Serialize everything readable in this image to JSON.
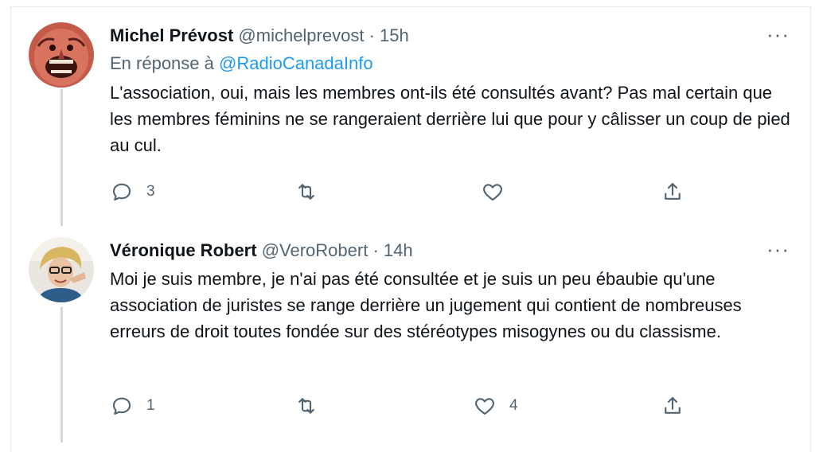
{
  "tweets": [
    {
      "name": "Michel Prévost",
      "handle": "@michelprevost",
      "separator": "·",
      "time": "15h",
      "reply_prefix": "En réponse à",
      "reply_to": "@RadioCanadaInfo",
      "text": "L'association, oui, mais les membres ont-ils été consultés avant? Pas mal certain que les membres féminins ne se rangeraient derrière lui que pour y câlisser un coup de pied au cul.",
      "reply_count": "3",
      "retweet_count": "",
      "like_count": ""
    },
    {
      "name": "Véronique Robert",
      "handle": "@VeroRobert",
      "separator": "·",
      "time": "14h",
      "text": "Moi je suis membre, je n'ai pas été consultée et je suis un peu ébaubie qu'une association de juristes se range derrière un jugement qui contient de nombreuses erreurs de droit toutes fondée sur des stéréotypes misogynes ou du classisme.",
      "reply_count": "1",
      "retweet_count": "",
      "like_count": "4"
    }
  ],
  "more_label": "···",
  "colors": {
    "link": "#1d9bf0",
    "muted": "#536471",
    "text": "#0f1419",
    "thread": "#cfd9de"
  },
  "icons": [
    "reply-icon",
    "retweet-icon",
    "like-icon",
    "share-icon",
    "more-icon"
  ]
}
